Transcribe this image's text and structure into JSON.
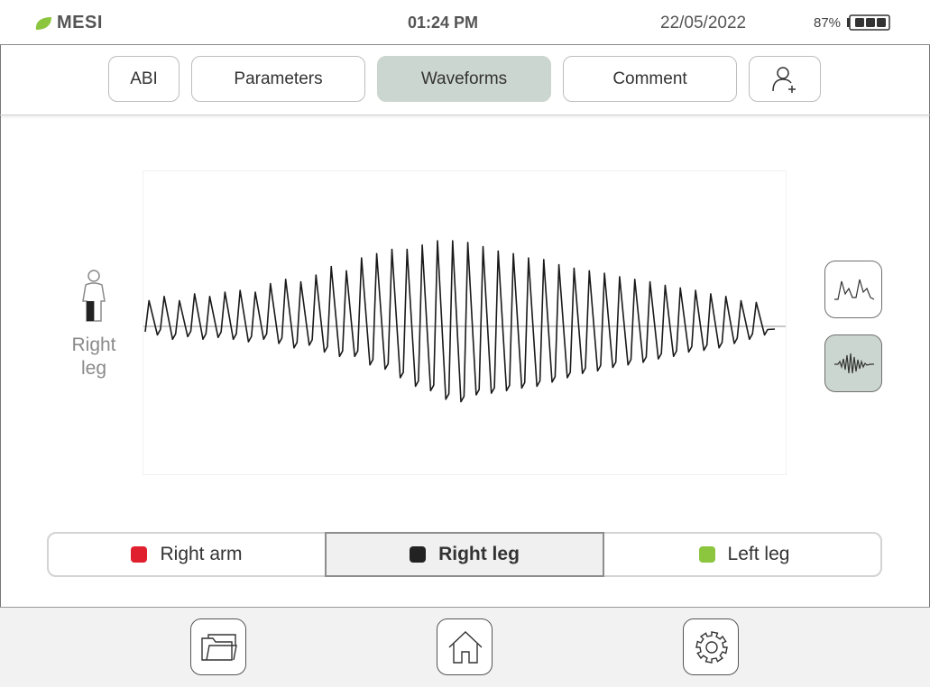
{
  "status": {
    "brand": "MESI",
    "time": "01:24 PM",
    "date": "22/05/2022",
    "battery": "87%"
  },
  "tabs": [
    {
      "label": "ABI",
      "active": false
    },
    {
      "label": "Parameters",
      "active": false
    },
    {
      "label": "Waveforms",
      "active": true
    },
    {
      "label": "Comment",
      "active": false
    }
  ],
  "limb": {
    "label_line1": "Right",
    "label_line2": "leg"
  },
  "channels": [
    {
      "label": "Right arm",
      "color": "#e0202f",
      "selected": false
    },
    {
      "label": "Right leg",
      "color": "#222222",
      "selected": true
    },
    {
      "label": "Left leg",
      "color": "#8cc63f",
      "selected": false
    }
  ],
  "view_modes": [
    {
      "icon": "pulse-waveform-icon",
      "active": false
    },
    {
      "icon": "oscillometric-waveform-icon",
      "active": true
    }
  ],
  "colors": {
    "brand_green": "#8cc63f",
    "active_tab": "#ccd6d0",
    "waveform": "#1a1a1a",
    "baseline": "#b5b5b5"
  },
  "chart_data": {
    "type": "line",
    "description_series": "oscillometric cuff pulsations (Right leg)",
    "peaks": [
      0.3,
      0.35,
      0.3,
      0.38,
      0.35,
      0.4,
      0.42,
      0.4,
      0.5,
      0.55,
      0.52,
      0.6,
      0.7,
      0.65,
      0.8,
      0.85,
      0.9,
      0.9,
      0.95,
      1.0,
      1.0,
      0.98,
      0.93,
      0.88,
      0.85,
      0.8,
      0.78,
      0.72,
      0.68,
      0.65,
      0.62,
      0.58,
      0.55,
      0.52,
      0.48,
      0.45,
      0.42,
      0.38,
      0.35,
      0.3,
      0.28
    ],
    "troughs": [
      0.1,
      0.15,
      0.12,
      0.15,
      0.13,
      0.15,
      0.18,
      0.15,
      0.2,
      0.25,
      0.22,
      0.3,
      0.35,
      0.35,
      0.45,
      0.5,
      0.6,
      0.7,
      0.75,
      0.85,
      0.88,
      0.8,
      0.78,
      0.75,
      0.72,
      0.7,
      0.65,
      0.6,
      0.55,
      0.52,
      0.48,
      0.45,
      0.42,
      0.38,
      0.35,
      0.3,
      0.28,
      0.25,
      0.2,
      0.15,
      0.1
    ]
  }
}
